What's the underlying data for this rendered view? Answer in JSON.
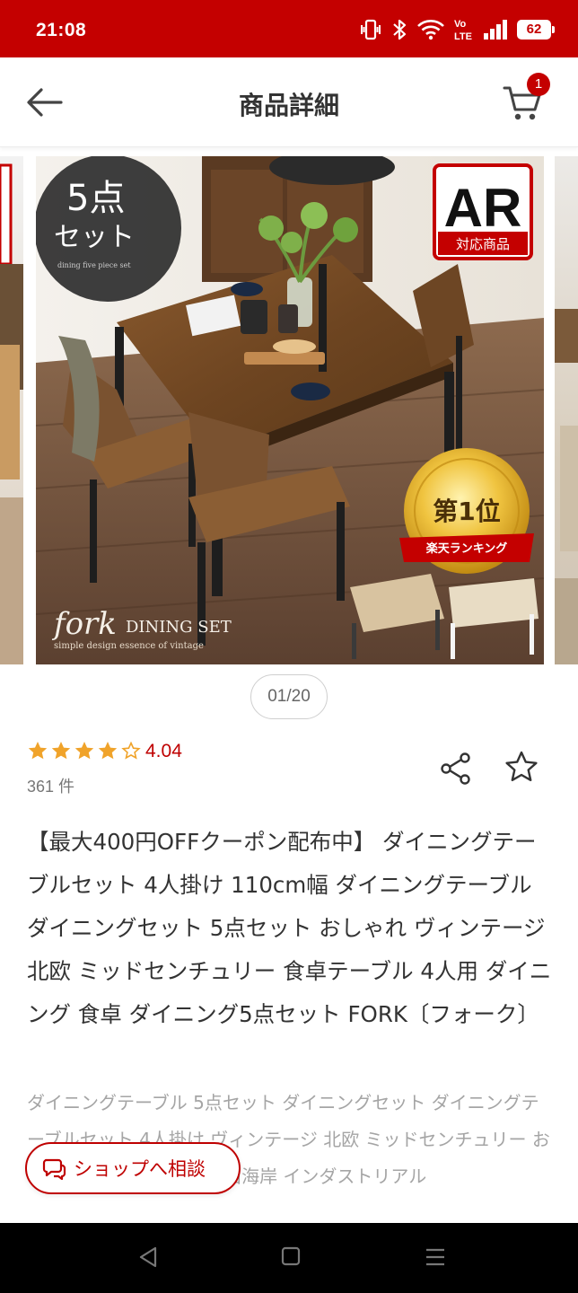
{
  "status": {
    "time": "21:08",
    "battery": "62",
    "network_label": "Vo LTE"
  },
  "appbar": {
    "title": "商品詳細",
    "cart_count": "1"
  },
  "photo": {
    "badge_line1": "5点",
    "badge_line2": "セット",
    "badge_caption": "dining five piece set",
    "ar_text": "AR",
    "ar_caption": "対応商品",
    "award_main": "第1位",
    "award_ribbon": "楽天ランキング",
    "brand_script": "fork",
    "brand_name": "DINING SET",
    "brand_tagline": "simple design essence of vintage"
  },
  "pager": {
    "label": "01/20"
  },
  "rating": {
    "value": "4.04",
    "stars": 4,
    "reviews": "361 件"
  },
  "product": {
    "title": "【最大400円OFFクーポン配布中】 ダイニングテーブルセット 4人掛け 110cm幅 ダイニングテーブル ダイニングセット 5点セット おしゃれ ヴィンテージ 北欧 ミッドセンチュリー 食卓テーブル 4人用 ダイニング 食卓 ダイニング5点セット FORK〔フォーク〕",
    "subtitle": "ダイニングテーブル 5点セット ダイニングセット ダイニングテーブルセット 4人掛け ヴィンテージ 北欧 ミッドセンチュリー おしゃれ ダイニング 食卓 西海岸 インダストリアル"
  },
  "consult": {
    "label": "ショップへ相談"
  },
  "colors": {
    "brand_red": "#c40000",
    "star": "#f0a32a",
    "gold": "#d9a521"
  }
}
